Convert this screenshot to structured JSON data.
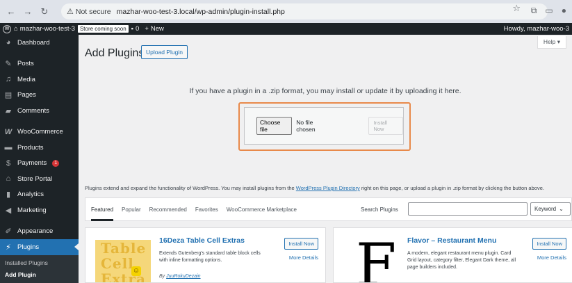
{
  "browser": {
    "not_secure": "Not secure",
    "url": "mazhar-woo-test-3.local/wp-admin/plugin-install.php"
  },
  "adminbar": {
    "site_name": "mazhar-woo-test-3",
    "store_badge": "Store coming soon",
    "comments_count": "0",
    "new_label": "New",
    "howdy": "Howdy, mazhar-woo-3"
  },
  "sidebar": {
    "items": [
      {
        "label": "Dashboard",
        "icon": "dashboard-icon"
      },
      {
        "label": "Posts",
        "icon": "pin-icon"
      },
      {
        "label": "Media",
        "icon": "media-icon"
      },
      {
        "label": "Pages",
        "icon": "pages-icon"
      },
      {
        "label": "Comments",
        "icon": "comment-icon"
      },
      {
        "label": "WooCommerce",
        "icon": "woo-icon"
      },
      {
        "label": "Products",
        "icon": "archive-icon"
      },
      {
        "label": "Payments",
        "icon": "dollar-icon",
        "badge": "1"
      },
      {
        "label": "Store Portal",
        "icon": "store-icon"
      },
      {
        "label": "Analytics",
        "icon": "chart-icon"
      },
      {
        "label": "Marketing",
        "icon": "megaphone-icon"
      },
      {
        "label": "Appearance",
        "icon": "brush-icon"
      },
      {
        "label": "Plugins",
        "icon": "plug-icon"
      }
    ],
    "plugins_submenu": [
      "Installed Plugins",
      "Add Plugin"
    ]
  },
  "main": {
    "help": "Help ▾",
    "title": "Add Plugins",
    "upload_button": "Upload Plugin",
    "upload_message": "If you have a plugin in a .zip format, you may install or update it by uploading it here.",
    "choose_file": "Choose file",
    "no_file": "No file chosen",
    "install_now": "Install Now",
    "extend_text_before": "Plugins extend and expand the functionality of WordPress. You may install plugins from the ",
    "extend_link": "WordPress Plugin Directory",
    "extend_text_after": " right on this page, or upload a plugin in .zip format by clicking the button above."
  },
  "filter": {
    "tabs": [
      "Featured",
      "Popular",
      "Recommended",
      "Favorites",
      "WooCommerce Marketplace"
    ],
    "search_label": "Search Plugins",
    "search_value": "",
    "keyword": "Keyword"
  },
  "plugins": [
    {
      "name": "16Deza Table Cell Extras",
      "description": "Extends Gutenberg's standard table block cells with inline formatting options.",
      "author_prefix": "By ",
      "author": "JuuRokuDezain",
      "install": "Install Now",
      "details": "More Details",
      "thumb_words": [
        "Table",
        "Cell",
        "Extra"
      ]
    },
    {
      "name": "Flavor – Restaurant Menu",
      "description": "A modern, elegant restaurant menu plugin. Card Grid layout, category filter, Elegant Dark theme, all page builders included.",
      "install": "Install Now",
      "details": "More Details",
      "thumb_letter": "F"
    }
  ]
}
